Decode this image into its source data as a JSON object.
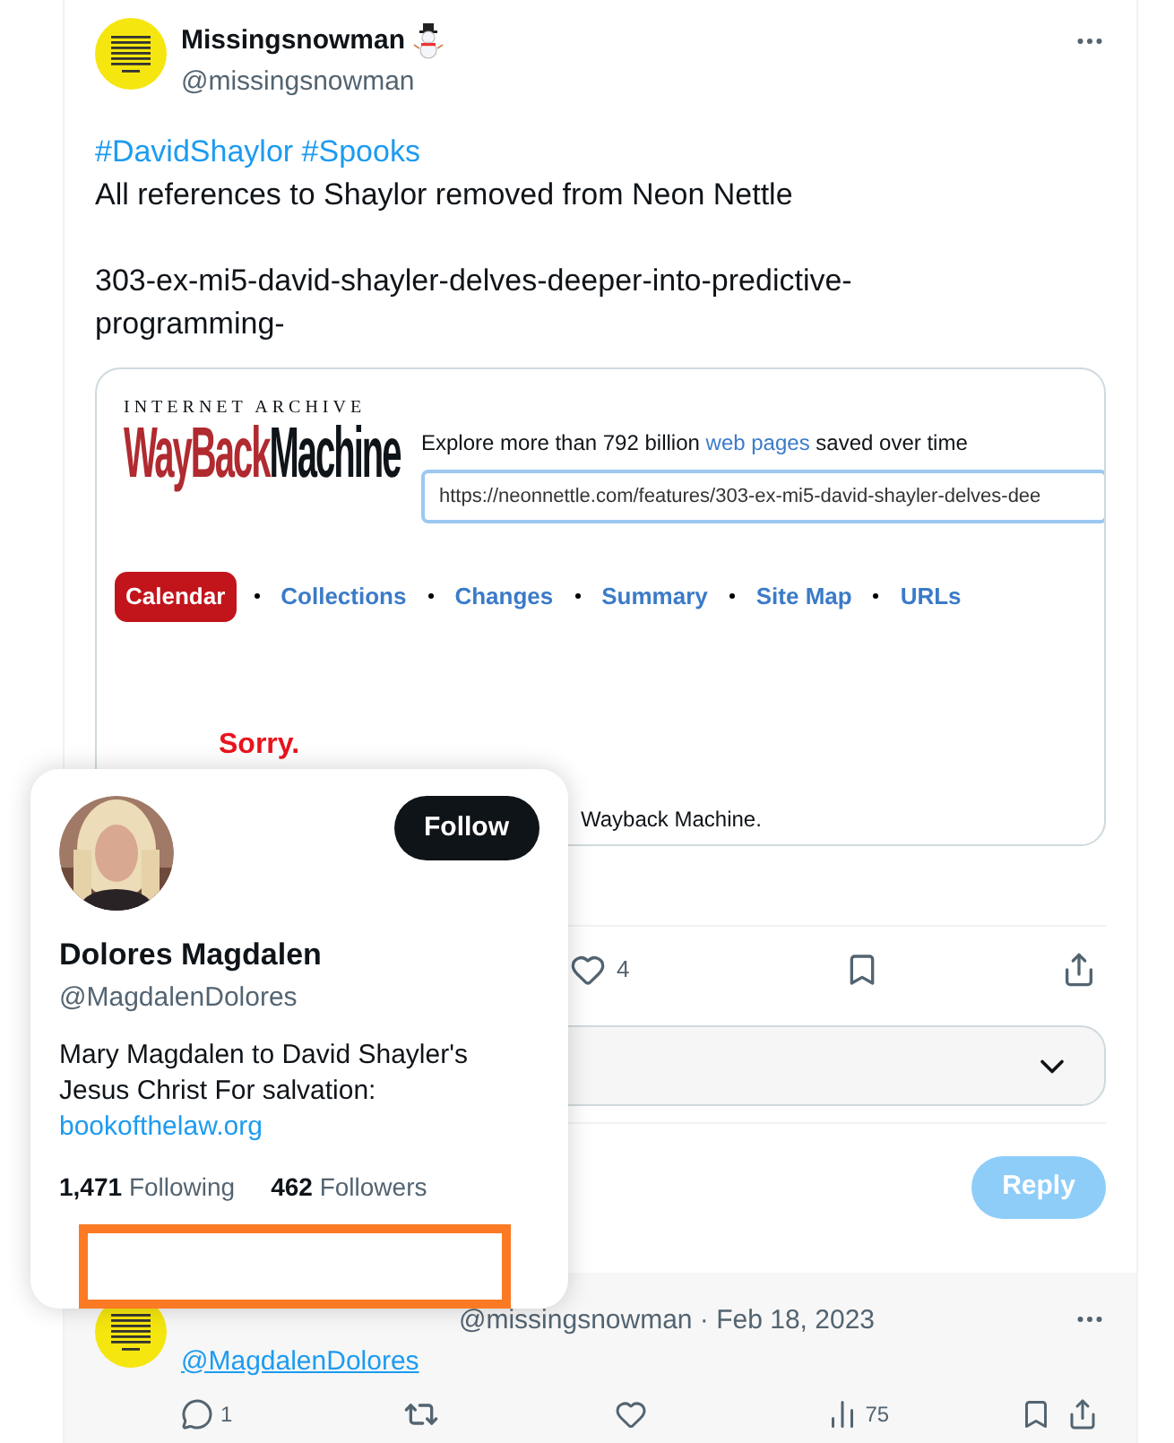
{
  "tweet": {
    "author": "Missingsnowman",
    "handle": "@missingsnowman",
    "hashtags": "#DavidShaylor #Spooks",
    "lines": [
      "All references to Shaylor removed from Neon Nettle",
      "303-ex-mi5-david-shayler-delves-deeper-into-predictive-programming-"
    ]
  },
  "embed": {
    "logo_top": "INTERNET ARCHIVE",
    "logo_red": "WayBack",
    "logo_black": "Machine",
    "explore_before": "Explore more than 792 billion",
    "explore_link": "web pages",
    "explore_after": "saved over time",
    "url_value": "https://neonnettle.com/features/303-ex-mi5-david-shayler-delves-dee",
    "nav": [
      {
        "label": "Calendar",
        "selected": true
      },
      {
        "label": "Collections",
        "selected": false
      },
      {
        "label": "Changes",
        "selected": false
      },
      {
        "label": "Summary",
        "selected": false
      },
      {
        "label": "Site Map",
        "selected": false
      },
      {
        "label": "URLs",
        "selected": false
      }
    ],
    "sorry": "Sorry.",
    "message_tail": "Wayback Machine."
  },
  "actions": {
    "likes": "4"
  },
  "reply_button": {
    "label": "Reply",
    "disabled": true
  },
  "popup": {
    "name": "Dolores Magdalen",
    "handle": "@MagdalenDolores",
    "bio": "Mary Magdalen to David Shayler's\nJesus Christ For salvation:",
    "link": "bookofthelaw.org",
    "following_count": "1,471",
    "following_label": "Following",
    "followers_count": "462",
    "followers_label": "Followers",
    "follow_button": "Follow"
  },
  "reply": {
    "meta": "@missingsnowman · Feb 18, 2023",
    "mention": "@MagdalenDolores",
    "replies": "1",
    "views": "75"
  }
}
